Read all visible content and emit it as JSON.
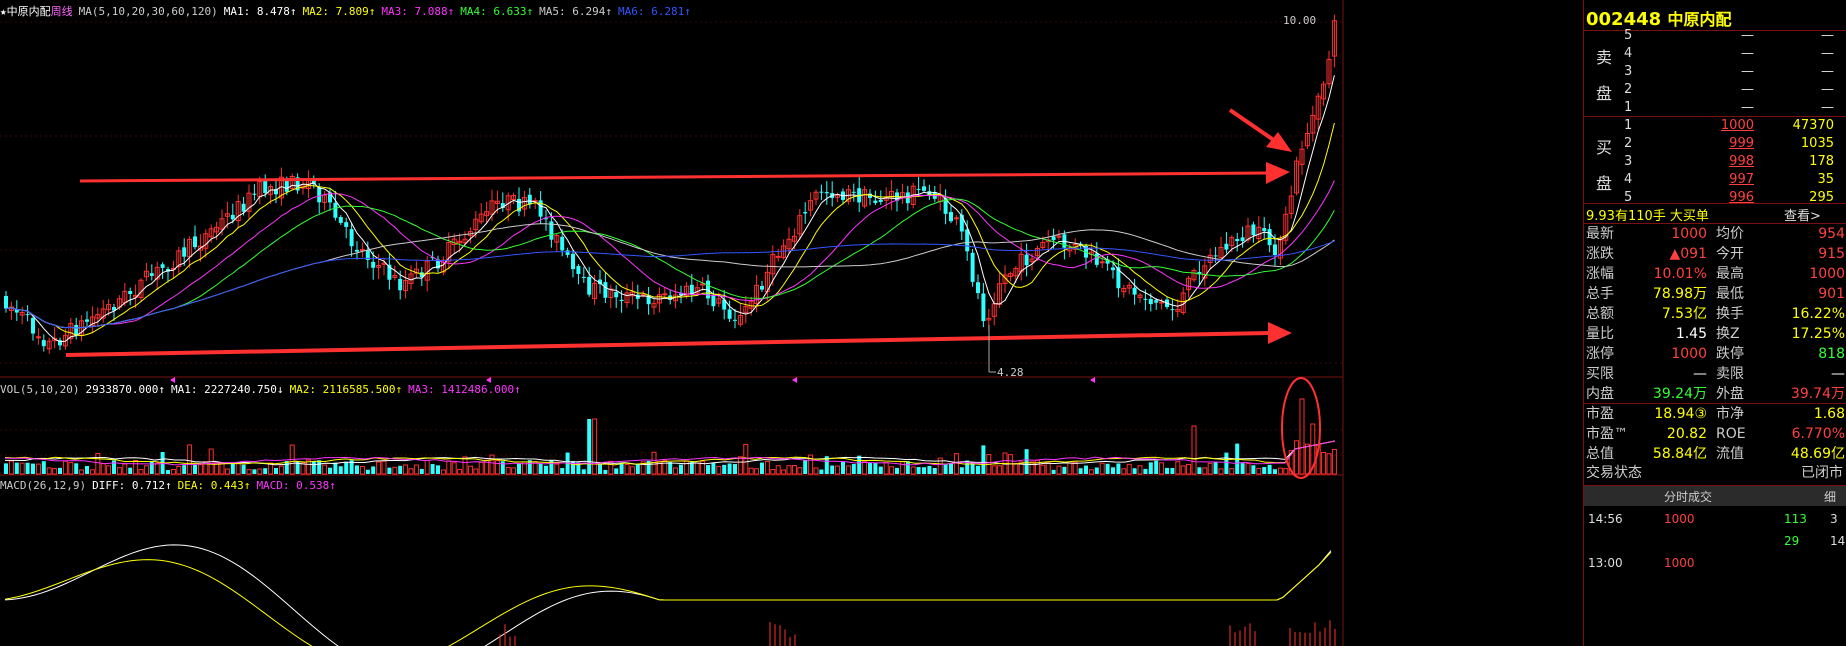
{
  "main_header": {
    "name": "★中原内配",
    "period": "周线",
    "ma_def": "MA(5,10,20,30,60,120)",
    "ma_items": [
      {
        "label": "MA1:",
        "value": "8.478↑",
        "color": "#ffffff"
      },
      {
        "label": "MA2:",
        "value": "7.809↑",
        "color": "#ffff00"
      },
      {
        "label": "MA3:",
        "value": "7.088↑",
        "color": "#ff33ff"
      },
      {
        "label": "MA4:",
        "value": "6.633↑",
        "color": "#33ff33"
      },
      {
        "label": "MA5:",
        "value": "6.294↑",
        "color": "#cccccc"
      },
      {
        "label": "MA6:",
        "value": "6.281↑",
        "color": "#3355ff"
      }
    ]
  },
  "price_labels": {
    "high": "10.00",
    "low": "4.28"
  },
  "vol_header": {
    "def": "VOL(5,10,20)",
    "value": "2933870.000↑",
    "items": [
      {
        "label": "MA1:",
        "value": "2227240.750↓",
        "color": "#ffffff"
      },
      {
        "label": "MA2:",
        "value": "2116585.500↑",
        "color": "#ffff00"
      },
      {
        "label": "MA3:",
        "value": "1412486.000↑",
        "color": "#ff33ff"
      }
    ]
  },
  "macd_header": {
    "def": "MACD(26,12,9)",
    "items": [
      {
        "label": "DIFF:",
        "value": "0.712↑",
        "color": "#ffffff"
      },
      {
        "label": "DEA:",
        "value": "0.443↑",
        "color": "#ffff00"
      },
      {
        "label": "MACD:",
        "value": "0.538↑",
        "color": "#ff33ff"
      }
    ]
  },
  "stock": {
    "code": "002448",
    "name": "中原内配"
  },
  "order_book": {
    "sell_label_1": "卖",
    "sell_label_2": "盘",
    "buy_label_1": "买",
    "buy_label_2": "盘",
    "sells": [
      {
        "level": "5",
        "price": "—",
        "vol": "—"
      },
      {
        "level": "4",
        "price": "—",
        "vol": "—"
      },
      {
        "level": "3",
        "price": "—",
        "vol": "—"
      },
      {
        "level": "2",
        "price": "—",
        "vol": "—"
      },
      {
        "level": "1",
        "price": "—",
        "vol": "—"
      }
    ],
    "buys": [
      {
        "level": "1",
        "price": "1000",
        "vol": "47370"
      },
      {
        "level": "2",
        "price": "999",
        "vol": "1035"
      },
      {
        "level": "3",
        "price": "998",
        "vol": "178"
      },
      {
        "level": "4",
        "price": "997",
        "vol": "35"
      },
      {
        "level": "5",
        "price": "996",
        "vol": "295"
      }
    ]
  },
  "trade_note": {
    "text": "9.93有110手 大买单",
    "link": "查看>"
  },
  "quote": [
    {
      "l1": "最新",
      "v1": "1000",
      "c1": "#ff4040",
      "l2": "均价",
      "v2": "954",
      "c2": "#ff4040"
    },
    {
      "l1": "涨跌",
      "v1": "▲091",
      "c1": "#ff4040",
      "l2": "今开",
      "v2": "915",
      "c2": "#ff4040"
    },
    {
      "l1": "涨幅",
      "v1": "10.01%",
      "c1": "#ff4040",
      "l2": "最高",
      "v2": "1000",
      "c2": "#ff4040"
    },
    {
      "l1": "总手",
      "v1": "78.98万",
      "c1": "#ffff00",
      "l2": "最低",
      "v2": "901",
      "c2": "#ff4040"
    },
    {
      "l1": "总额",
      "v1": "7.53亿",
      "c1": "#ffff00",
      "l2": "换手",
      "v2": "16.22%",
      "c2": "#ffff00"
    },
    {
      "l1": "量比",
      "v1": "1.45",
      "c1": "#ffffff",
      "l2": "换Z",
      "v2": "17.25%",
      "c2": "#ffff00"
    },
    {
      "l1": "涨停",
      "v1": "1000",
      "c1": "#ff4040",
      "l2": "跌停",
      "v2": "818",
      "c2": "#33ff33"
    },
    {
      "l1": "买限",
      "v1": "—",
      "c1": "#ffffff",
      "l2": "卖限",
      "v2": "—",
      "c2": "#ffffff"
    },
    {
      "l1": "内盘",
      "v1": "39.24万",
      "c1": "#33ff33",
      "l2": "外盘",
      "v2": "39.74万",
      "c2": "#ff4040"
    },
    {
      "l1": "市盈",
      "v1": "18.94③",
      "c1": "#ffff00",
      "l2": "市净",
      "v2": "1.68",
      "c2": "#ffff00"
    },
    {
      "l1": "市盈™",
      "v1": "20.82",
      "c1": "#ffff00",
      "l2": "ROE",
      "v2": "6.770%",
      "c2": "#ff4040"
    },
    {
      "l1": "总值",
      "v1": "58.84亿",
      "c1": "#ffff00",
      "l2": "流值",
      "v2": "48.69亿",
      "c2": "#ffff00"
    }
  ],
  "status": {
    "label": "交易状态",
    "value": "已闭市"
  },
  "tick_panel": {
    "title": "分时成交",
    "tab": "细"
  },
  "ticks": [
    {
      "time": "14:56",
      "price": "1000",
      "vol": "113",
      "flag": "3"
    },
    {
      "time": "",
      "price": "",
      "vol": "29",
      "flag": "14"
    },
    {
      "time": "13:00",
      "price": "1000",
      "vol": "",
      "flag": ""
    }
  ]
}
